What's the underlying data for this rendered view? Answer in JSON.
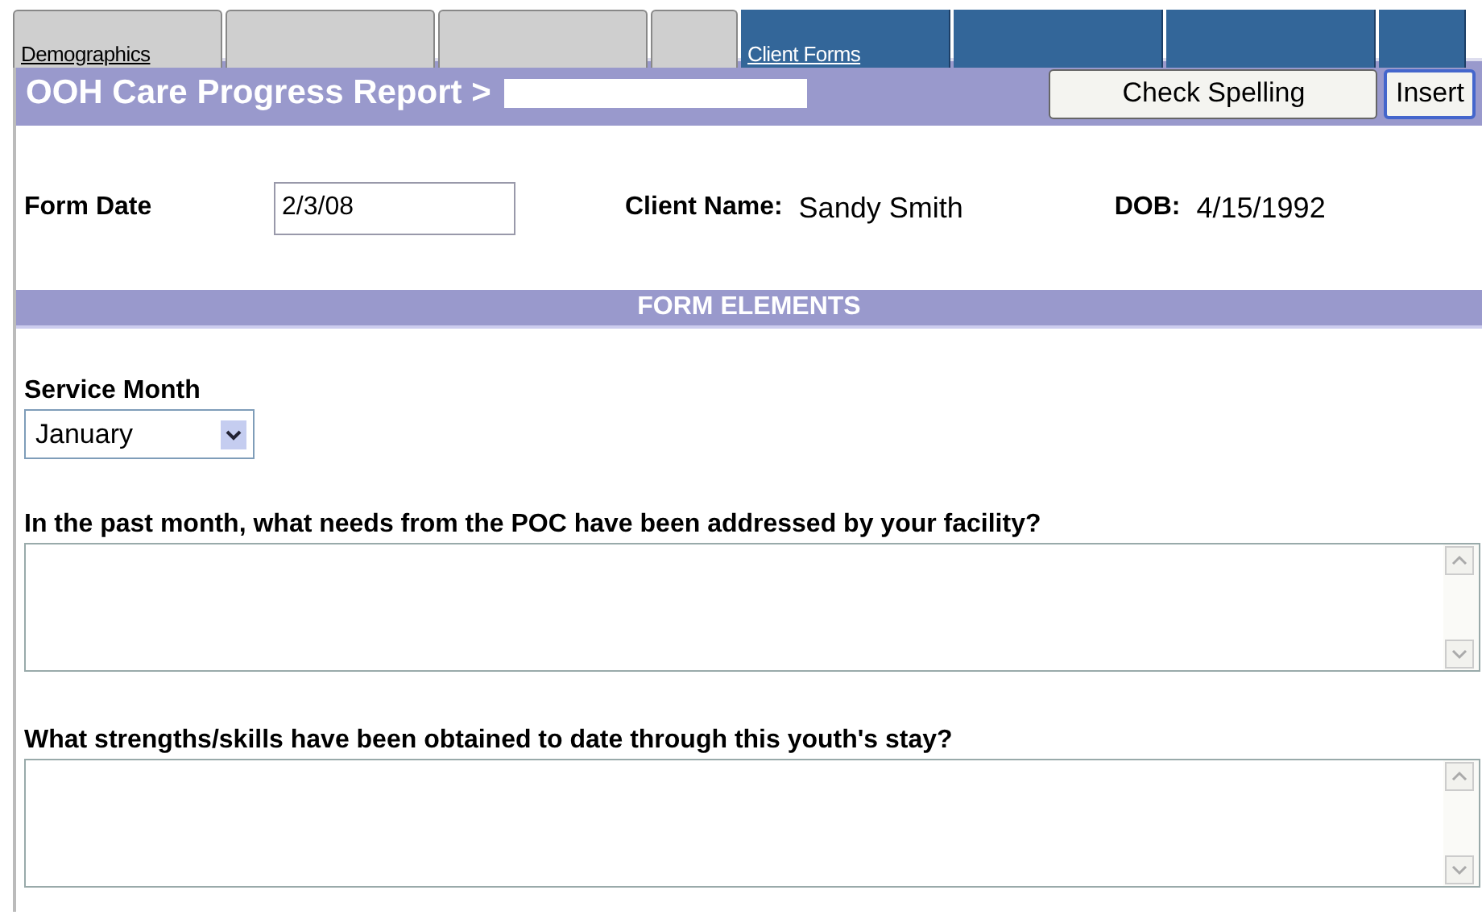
{
  "tabs": [
    {
      "label": "Demographics",
      "kind": "general"
    },
    {
      "kind": "general"
    },
    {
      "kind": "general"
    },
    {
      "kind": "general",
      "narrow": true
    },
    {
      "label": "Client Forms",
      "kind": "forms"
    },
    {
      "kind": "forms"
    },
    {
      "kind": "forms"
    },
    {
      "kind": "forms",
      "narrow": true
    }
  ],
  "header": {
    "title": "OOH Care Progress Report >",
    "buttons": [
      {
        "label": "Check Spelling",
        "focused": false
      },
      {
        "label": "Insert",
        "focused": true
      }
    ]
  },
  "info": [
    {
      "label": "Form Date",
      "value": "2/3/08",
      "kind": "input"
    },
    {
      "label": "Client Name:",
      "value": "Sandy Smith",
      "kind": "text"
    },
    {
      "label": "DOB:",
      "value": "4/15/1992",
      "kind": "text"
    }
  ],
  "section_title": "FORM ELEMENTS",
  "service_month": {
    "label": "Service Month",
    "value": "January"
  },
  "questions": [
    {
      "label": "In the past month, what needs from the POC have been addressed by your facility?"
    },
    {
      "label": "What strengths/skills have been obtained to date through this youth's stay?"
    }
  ]
}
